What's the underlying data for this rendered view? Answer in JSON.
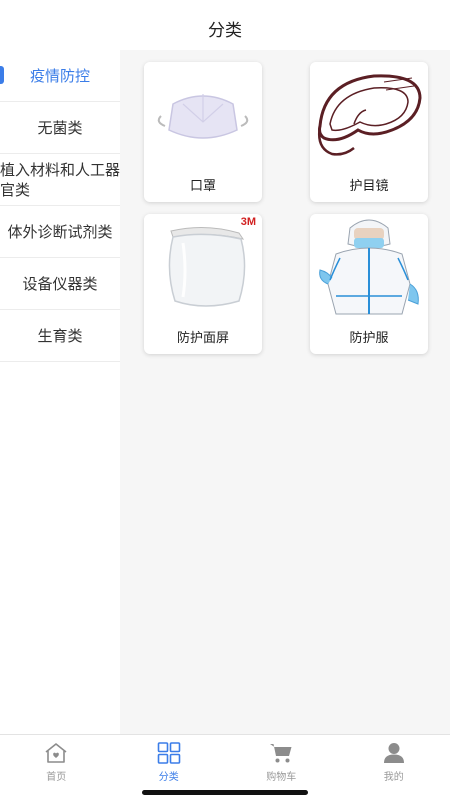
{
  "header": {
    "title": "分类"
  },
  "sidebar": {
    "items": [
      {
        "label": "疫情防控",
        "active": true
      },
      {
        "label": "无菌类"
      },
      {
        "label": "植入材料和人工器官类"
      },
      {
        "label": "体外诊断试剂类"
      },
      {
        "label": "设备仪器类"
      },
      {
        "label": "生育类"
      }
    ]
  },
  "products": [
    {
      "name": "口罩",
      "icon": "face-mask-image"
    },
    {
      "name": "护目镜",
      "icon": "goggles-image"
    },
    {
      "name": "防护面屏",
      "icon": "face-shield-image",
      "brand": "3M"
    },
    {
      "name": "防护服",
      "icon": "protective-suit-image"
    }
  ],
  "tabbar": {
    "items": [
      {
        "label": "首页",
        "icon": "home-icon"
      },
      {
        "label": "分类",
        "icon": "category-icon",
        "active": true
      },
      {
        "label": "购物车",
        "icon": "cart-icon"
      },
      {
        "label": "我的",
        "icon": "profile-icon"
      }
    ]
  },
  "colors": {
    "accent": "#3b7de8",
    "inactive": "#999999",
    "main_bg": "#f6f6f6"
  }
}
